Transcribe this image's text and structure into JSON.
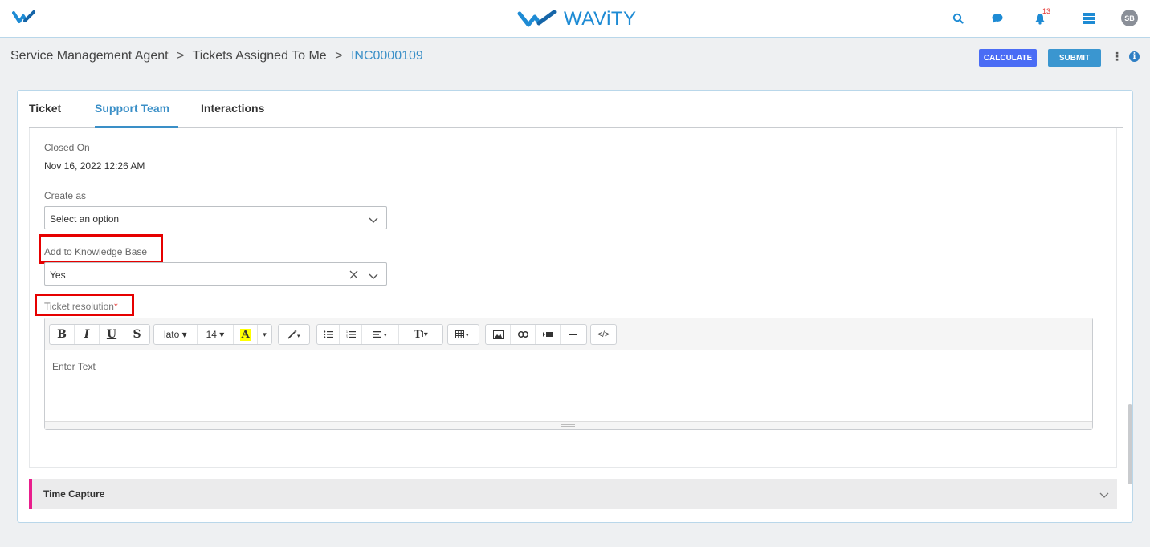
{
  "header": {
    "brand_name": "WAViTY",
    "notification_count": "13",
    "avatar_initials": "SB",
    "icons": [
      "search-icon",
      "chat-icon",
      "bell-icon",
      "apps-grid-icon"
    ]
  },
  "breadcrumb": {
    "items": [
      "Service Management Agent",
      "Tickets Assigned To Me"
    ],
    "separator": ">",
    "current": "INC0000109"
  },
  "actions": {
    "calculate_label": "CALCULATE",
    "submit_label": "SUBMIT"
  },
  "tabs": [
    {
      "label": "Ticket",
      "active": false
    },
    {
      "label": "Support Team",
      "active": true
    },
    {
      "label": "Interactions",
      "active": false
    }
  ],
  "form": {
    "closed_on": {
      "label": "Closed On",
      "value": "Nov 16, 2022 12:26 AM"
    },
    "create_as": {
      "label": "Create as",
      "value": "Select an option"
    },
    "add_to_kb": {
      "label": "Add to Knowledge Base",
      "value": "Yes"
    },
    "ticket_resolution": {
      "label": "Ticket resolution",
      "required_mark": "*",
      "placeholder": "Enter Text"
    }
  },
  "editor_toolbar": {
    "font_name": "lato",
    "font_size": "14",
    "highlight_letter": "A",
    "text_style_label": "T",
    "code_label": "</>"
  },
  "time_capture": {
    "title": "Time Capture"
  },
  "colors": {
    "brand_blue": "#1e8bd4",
    "link_blue": "#3a8fc7",
    "calculate_button": "#4a6cf5",
    "submit_button": "#3a96d0",
    "highlight_red": "#e60000",
    "time_capture_accent": "#e91e8c"
  }
}
